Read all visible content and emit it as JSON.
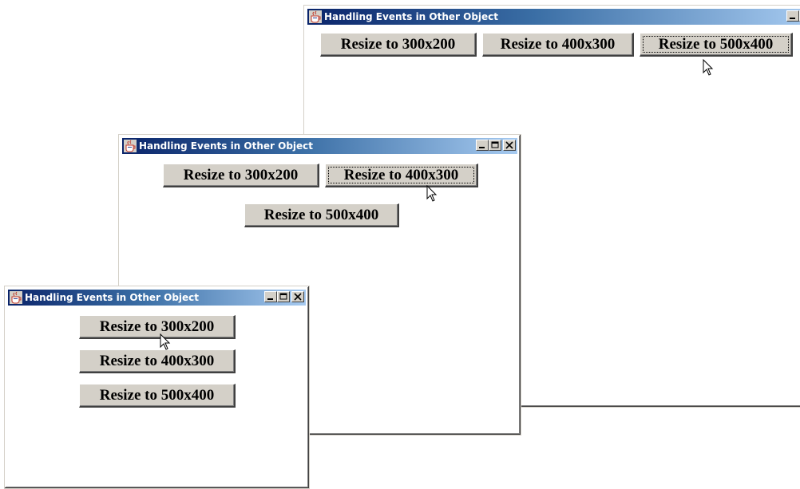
{
  "windows": [
    {
      "title": "Handling Events in Other Object",
      "buttons": [
        {
          "label": "Resize to 300x200"
        },
        {
          "label": "Resize to 400x300"
        },
        {
          "label": "Resize to 500x400",
          "state": "focused"
        }
      ]
    },
    {
      "title": "Handling Events in Other Object",
      "buttons": [
        {
          "label": "Resize to 300x200"
        },
        {
          "label": "Resize to 400x300",
          "state": "focused"
        },
        {
          "label": "Resize to 500x400"
        }
      ]
    },
    {
      "title": "Handling Events in Other Object",
      "buttons": [
        {
          "label": "Resize to 300x200"
        },
        {
          "label": "Resize to 400x300"
        },
        {
          "label": "Resize to 500x400"
        }
      ]
    }
  ],
  "icons": {
    "app": "java-cup-icon",
    "minimize": "minimize-icon",
    "maximize": "maximize-icon",
    "close": "close-icon",
    "cursor": "mouse-pointer-icon"
  },
  "colors": {
    "titlebar_start": "#0a246a",
    "titlebar_end": "#a6caf0",
    "button_face": "#d4d0c8"
  }
}
